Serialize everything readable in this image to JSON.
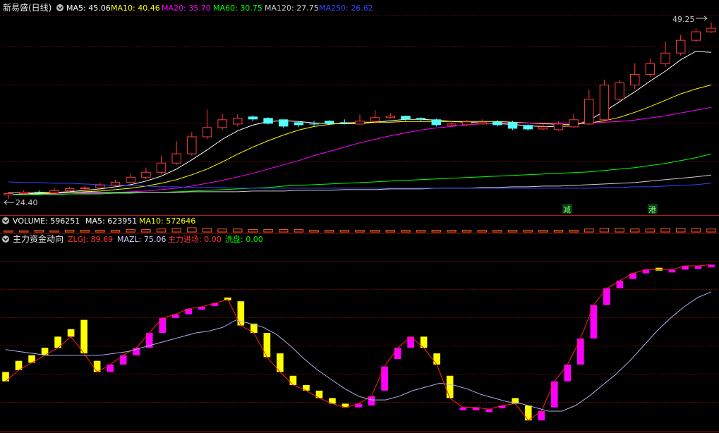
{
  "main_panel": {
    "title": "新易盛(日线)",
    "ma_readouts": [
      {
        "label": "MA5: 45.06",
        "color": "#ffffff"
      },
      {
        "label": "MA10: 40.46",
        "color": "#ffff00"
      },
      {
        "label": "MA20: 35.70",
        "color": "#ff00ff"
      },
      {
        "label": "MA60: 30.75",
        "color": "#00ff00"
      },
      {
        "label": "MA120: 27.75",
        "color": "#cccccc"
      },
      {
        "label": "MA250: 26.62",
        "color": "#3344ff"
      }
    ],
    "high_label": "49.25",
    "low_label": "24.40",
    "markers": [
      "减",
      "港"
    ]
  },
  "volume_panel": {
    "readouts": [
      {
        "label": "VOLUME: 596251",
        "color": "#ffffff"
      },
      {
        "label": "MA5: 623951",
        "color": "#ffffff"
      },
      {
        "label": "MA10: 572646",
        "color": "#ffff00"
      }
    ]
  },
  "indicator_panel": {
    "title": "主力资金动向",
    "readouts": [
      {
        "label": "ZLGJ: 89.69",
        "color": "#ff3333"
      },
      {
        "label": "MAZL: 75.06",
        "color": "#cfd4ff"
      },
      {
        "label": "主力进场: 0.00",
        "color": "#ff3333"
      },
      {
        "label": "洗盘: 0.00",
        "color": "#00ff00"
      }
    ]
  },
  "chart_data": [
    {
      "type": "candlestick",
      "title": "新易盛(日线)",
      "ylim": [
        24.4,
        49.25
      ],
      "series": [
        {
          "name": "K",
          "open": [
            25.0,
            25.2,
            25.4,
            25.3,
            25.6,
            25.9,
            26.0,
            26.4,
            26.8,
            27.5,
            28.2,
            29.5,
            30.8,
            33.2,
            34.5,
            35.0,
            36.0,
            35.8,
            35.6,
            35.2,
            35.0,
            35.4,
            35.2,
            35.0,
            35.4,
            35.9,
            36.1,
            35.8,
            35.6,
            34.8,
            34.9,
            35.0,
            35.3,
            35.2,
            34.8,
            34.3,
            34.2,
            34.6,
            35.0,
            35.6,
            38.5,
            40.5,
            42.0,
            43.5,
            45.0,
            46.8,
            48.0
          ],
          "close": [
            25.2,
            25.4,
            25.3,
            25.6,
            25.9,
            26.0,
            26.4,
            26.8,
            27.5,
            28.2,
            29.5,
            30.8,
            33.2,
            34.5,
            35.6,
            35.8,
            35.6,
            35.0,
            34.6,
            34.8,
            34.9,
            35.0,
            35.1,
            35.4,
            35.9,
            36.1,
            35.6,
            35.6,
            34.8,
            35.0,
            35.3,
            35.2,
            34.8,
            34.3,
            34.2,
            34.6,
            35.0,
            35.6,
            38.5,
            40.5,
            40.8,
            42.0,
            43.5,
            45.0,
            46.8,
            48.0,
            48.5
          ],
          "high": [
            25.4,
            25.6,
            25.6,
            25.9,
            26.1,
            26.3,
            26.7,
            27.1,
            27.9,
            28.8,
            30.5,
            32.5,
            33.8,
            37.0,
            36.4,
            36.3,
            36.2,
            35.9,
            35.5,
            35.3,
            35.4,
            35.5,
            35.6,
            36.3,
            36.9,
            36.5,
            36.1,
            35.9,
            35.7,
            35.4,
            35.5,
            35.6,
            35.5,
            35.4,
            34.9,
            35.0,
            35.3,
            36.4,
            39.8,
            41.2,
            41.2,
            43.5,
            44.2,
            46.6,
            47.5,
            48.4,
            49.25
          ],
          "low": [
            24.4,
            25.0,
            25.1,
            25.1,
            25.4,
            25.7,
            25.8,
            26.2,
            26.6,
            27.2,
            27.9,
            29.2,
            30.5,
            32.8,
            34.1,
            34.6,
            35.3,
            34.9,
            34.4,
            34.5,
            34.7,
            34.8,
            34.9,
            34.8,
            35.1,
            35.7,
            35.4,
            35.3,
            34.6,
            34.6,
            34.7,
            34.9,
            34.6,
            34.1,
            34.0,
            34.1,
            34.0,
            34.4,
            34.8,
            35.3,
            38.2,
            39.9,
            41.6,
            43.0,
            44.6,
            46.5,
            47.8
          ]
        },
        {
          "name": "MA5",
          "values": [
            25.0,
            25.1,
            25.2,
            25.3,
            25.4,
            25.6,
            25.8,
            26.1,
            26.4,
            26.9,
            27.6,
            28.6,
            29.9,
            31.3,
            32.8,
            34.0,
            34.8,
            35.3,
            35.4,
            35.3,
            35.1,
            35.0,
            35.0,
            35.0,
            35.2,
            35.4,
            35.6,
            35.6,
            35.5,
            35.3,
            35.2,
            35.1,
            35.0,
            34.9,
            34.7,
            34.6,
            34.6,
            34.7,
            35.5,
            36.7,
            38.1,
            39.5,
            41.0,
            42.4,
            44.0,
            45.2,
            45.06
          ]
        },
        {
          "name": "MA10",
          "values": [
            25.0,
            25.0,
            25.1,
            25.2,
            25.3,
            25.4,
            25.5,
            25.7,
            25.9,
            26.2,
            26.6,
            27.1,
            27.8,
            28.6,
            29.6,
            30.7,
            31.7,
            32.6,
            33.4,
            34.1,
            34.6,
            34.9,
            35.1,
            35.2,
            35.2,
            35.2,
            35.3,
            35.3,
            35.3,
            35.3,
            35.3,
            35.3,
            35.3,
            35.2,
            35.1,
            35.0,
            34.9,
            34.9,
            35.1,
            35.4,
            35.9,
            36.6,
            37.4,
            38.3,
            39.2,
            39.9,
            40.46
          ]
        },
        {
          "name": "MA20",
          "values": [
            25.0,
            25.0,
            25.0,
            25.1,
            25.1,
            25.2,
            25.2,
            25.3,
            25.4,
            25.5,
            25.7,
            25.9,
            26.2,
            26.6,
            27.0,
            27.5,
            28.0,
            28.6,
            29.2,
            29.8,
            30.5,
            31.1,
            31.7,
            32.3,
            32.8,
            33.3,
            33.7,
            34.1,
            34.4,
            34.6,
            34.8,
            35.0,
            35.1,
            35.1,
            35.1,
            35.1,
            35.1,
            35.1,
            35.1,
            35.2,
            35.3,
            35.5,
            35.8,
            36.1,
            36.5,
            36.9,
            37.3
          ]
        },
        {
          "name": "MA60",
          "values": [
            25.0,
            25.0,
            25.0,
            25.0,
            25.1,
            25.1,
            25.1,
            25.2,
            25.2,
            25.3,
            25.3,
            25.4,
            25.5,
            25.6,
            25.7,
            25.8,
            25.9,
            26.0,
            26.2,
            26.3,
            26.4,
            26.5,
            26.6,
            26.7,
            26.8,
            26.9,
            27.0,
            27.1,
            27.2,
            27.3,
            27.4,
            27.5,
            27.6,
            27.7,
            27.8,
            27.9,
            28.0,
            28.1,
            28.2,
            28.4,
            28.6,
            28.8,
            29.1,
            29.4,
            29.8,
            30.2,
            30.75
          ]
        },
        {
          "name": "MA120",
          "values": [
            25.3,
            25.3,
            25.3,
            25.3,
            25.3,
            25.3,
            25.3,
            25.3,
            25.3,
            25.3,
            25.3,
            25.3,
            25.4,
            25.4,
            25.4,
            25.4,
            25.5,
            25.5,
            25.5,
            25.6,
            25.6,
            25.6,
            25.7,
            25.7,
            25.7,
            25.8,
            25.8,
            25.8,
            25.9,
            25.9,
            25.9,
            26.0,
            26.0,
            26.1,
            26.1,
            26.2,
            26.2,
            26.3,
            26.4,
            26.5,
            26.6,
            26.7,
            26.9,
            27.1,
            27.3,
            27.5,
            27.75
          ]
        },
        {
          "name": "MA250",
          "values": [
            26.8,
            26.7,
            26.7,
            26.6,
            26.6,
            26.5,
            26.4,
            26.3,
            26.3,
            26.2,
            26.1,
            26.1,
            26.0,
            26.0,
            26.0,
            25.9,
            25.9,
            25.9,
            25.9,
            25.9,
            25.9,
            25.9,
            25.9,
            25.9,
            25.9,
            25.9,
            25.9,
            25.9,
            25.9,
            25.9,
            25.9,
            25.9,
            25.9,
            25.9,
            25.9,
            25.9,
            25.9,
            25.9,
            25.9,
            26.0,
            26.0,
            26.1,
            26.1,
            26.2,
            26.3,
            26.4,
            26.62
          ]
        }
      ]
    },
    {
      "type": "bar",
      "title": "VOLUME",
      "values": [
        2,
        2,
        3,
        2,
        3,
        3,
        3,
        3,
        4,
        4,
        5,
        6,
        7,
        6,
        5,
        5,
        4,
        4,
        4,
        4,
        3,
        3,
        3,
        3,
        3,
        3,
        3,
        3,
        3,
        3,
        3,
        3,
        3,
        3,
        3,
        3,
        3,
        3,
        5,
        6,
        6,
        5,
        5,
        6,
        6,
        6,
        5
      ]
    },
    {
      "type": "bar",
      "title": "主力资金动向",
      "ylim": [
        0,
        100
      ],
      "series": [
        {
          "name": "ZLGJ",
          "start": [
            32,
            38,
            41,
            45,
            51,
            55,
            60,
            38,
            32,
            36,
            41,
            45,
            53,
            61,
            63,
            66,
            69,
            72,
            70,
            58,
            53,
            42,
            30,
            25,
            22,
            18,
            15,
            13,
            14,
            22,
            39,
            45,
            51,
            42,
            30,
            13,
            12,
            12,
            13,
            18,
            14,
            6,
            13,
            27,
            36,
            50,
            68,
            77,
            82,
            85,
            88,
            87,
            87,
            88,
            89.69
          ],
          "end": [
            27,
            33,
            37,
            41,
            45,
            51,
            42,
            32,
            36,
            41,
            45,
            53,
            61,
            63,
            66,
            67,
            69,
            71,
            57,
            53,
            40,
            32,
            25,
            22,
            18,
            15,
            13,
            15,
            19,
            35,
            45,
            51,
            45,
            36,
            18,
            13,
            13,
            12,
            14,
            15,
            6,
            11,
            27,
            36,
            50,
            68,
            77,
            81,
            85,
            87,
            87,
            87,
            89,
            89,
            89.69
          ]
        },
        {
          "name": "MAZL",
          "values": [
            44,
            43,
            42,
            41,
            41,
            41,
            41,
            41,
            42,
            43,
            45,
            47,
            49,
            51,
            53,
            54,
            56,
            60,
            58,
            56,
            52,
            46,
            39,
            33,
            28,
            23,
            19,
            17,
            17,
            19,
            22,
            24,
            26,
            25,
            23,
            20,
            18,
            16,
            15,
            13,
            11,
            11,
            14,
            19,
            25,
            31,
            38,
            46,
            54,
            61,
            67,
            72,
            75.06
          ]
        }
      ]
    }
  ]
}
